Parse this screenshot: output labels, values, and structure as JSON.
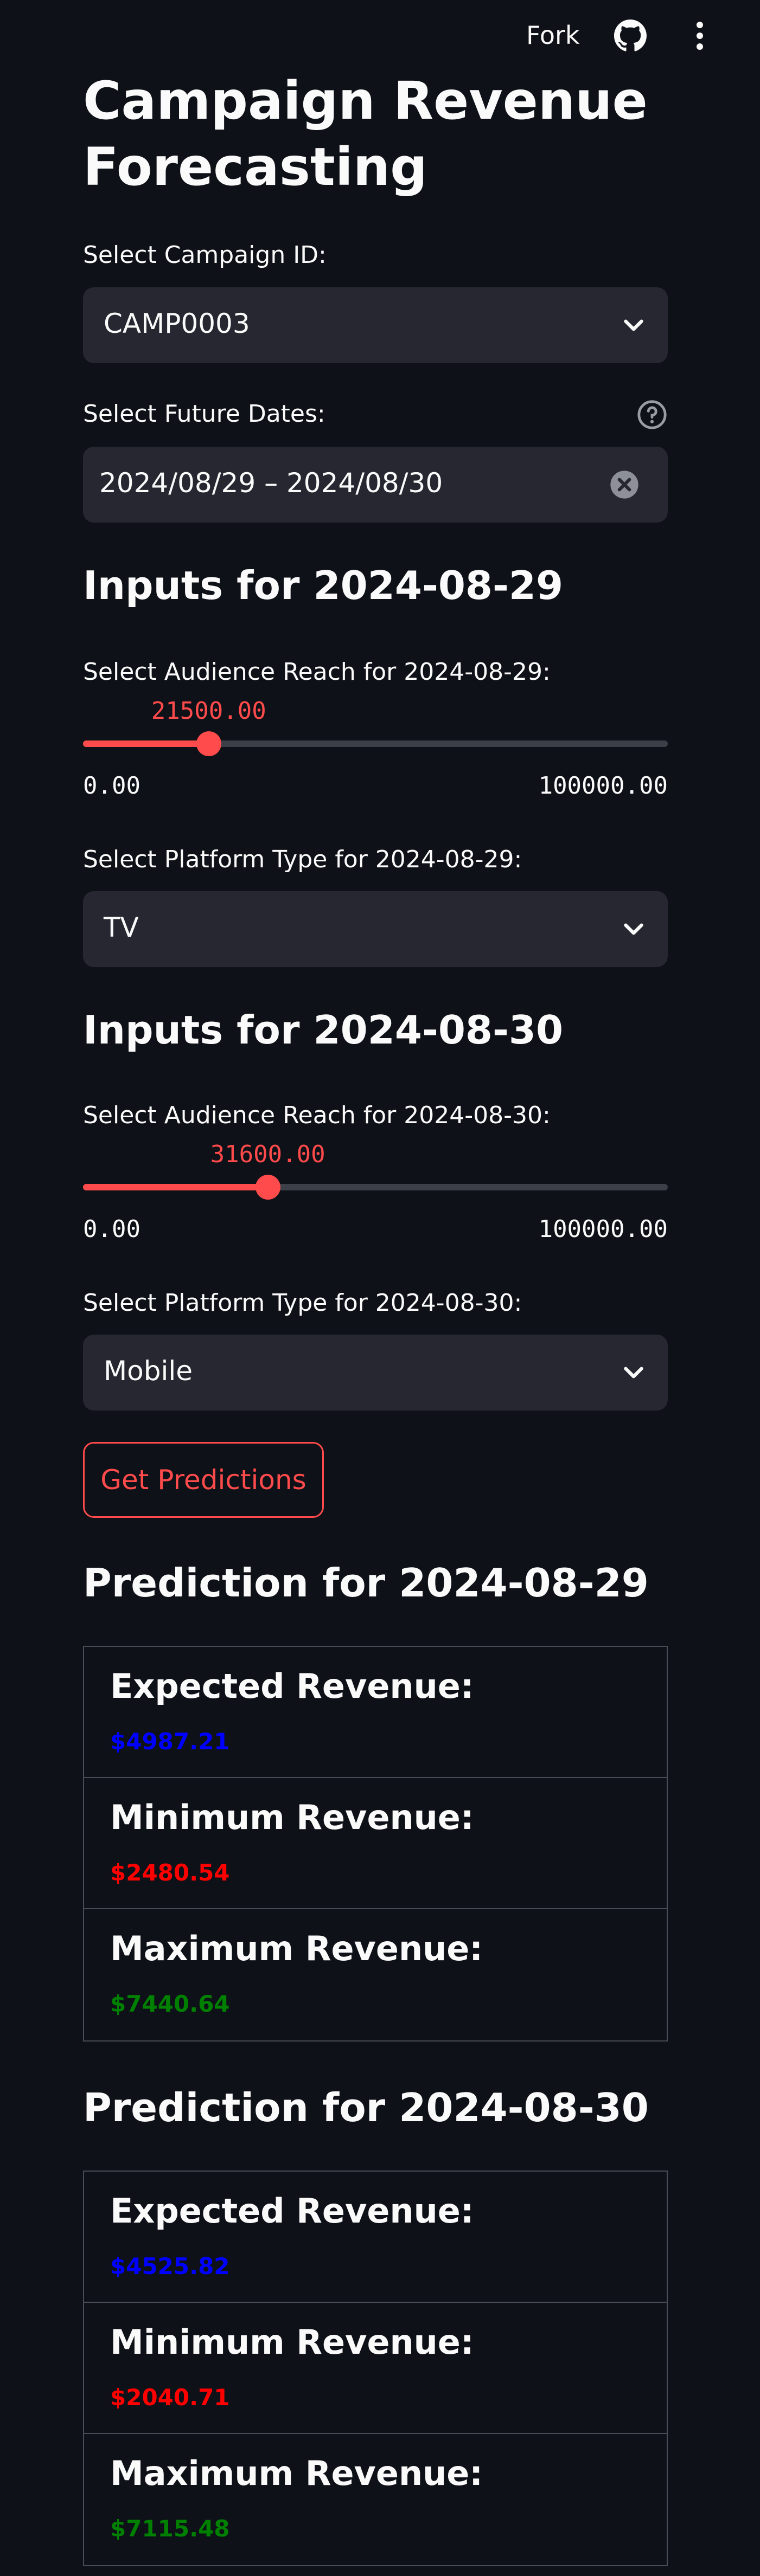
{
  "header": {
    "fork_label": "Fork"
  },
  "title": "Campaign Revenue Forecasting",
  "campaign": {
    "label": "Select Campaign ID:",
    "value": "CAMP0003"
  },
  "dates": {
    "label": "Select Future Dates:",
    "value": "2024/08/29 – 2024/08/30"
  },
  "days": [
    {
      "heading": "Inputs for 2024-08-29",
      "reach_label": "Select Audience Reach for 2024-08-29:",
      "reach_value": "21500.00",
      "reach_fraction": 0.215,
      "min": "0.00",
      "max": "100000.00",
      "platform_label": "Select Platform Type for 2024-08-29:",
      "platform_value": "TV"
    },
    {
      "heading": "Inputs for 2024-08-30",
      "reach_label": "Select Audience Reach for 2024-08-30:",
      "reach_value": "31600.00",
      "reach_fraction": 0.316,
      "min": "0.00",
      "max": "100000.00",
      "platform_label": "Select Platform Type for 2024-08-30:",
      "platform_value": "Mobile"
    }
  ],
  "predict_button": "Get Predictions",
  "predictions": [
    {
      "heading": "Prediction for 2024-08-29",
      "expected_label": "Expected Revenue:",
      "expected": "$4987.21",
      "minimum_label": "Minimum Revenue:",
      "minimum": "$2480.54",
      "maximum_label": "Maximum Revenue:",
      "maximum": "$7440.64"
    },
    {
      "heading": "Prediction for 2024-08-30",
      "expected_label": "Expected Revenue:",
      "expected": "$4525.82",
      "minimum_label": "Minimum Revenue:",
      "minimum": "$2040.71",
      "maximum_label": "Maximum Revenue:",
      "maximum": "$7115.48"
    }
  ],
  "colors": {
    "accent": "#ff4b4b",
    "expected": "#0000ff",
    "minimum": "#ff0000",
    "maximum": "#008000"
  }
}
